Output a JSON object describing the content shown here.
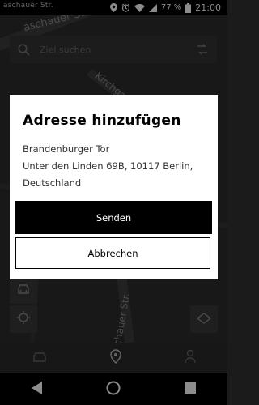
{
  "status_bar": {
    "left_text": "aschauer Str.",
    "battery_percent": "77 %",
    "time": "21:00"
  },
  "map": {
    "street_labels": [
      "aschauer Str.",
      "Kirchgasse",
      "chauer Str."
    ]
  },
  "search": {
    "placeholder": "Ziel suchen"
  },
  "dialog": {
    "title": "Adresse hinzufügen",
    "address_lines": [
      "Brandenburger Tor",
      "Unter den Linden 69B, 10117 Berlin,",
      "Deutschland"
    ],
    "send_label": "Senden",
    "cancel_label": "Abbrechen"
  },
  "icons": {
    "status": [
      "location-icon",
      "alarm-icon",
      "wifi-icon",
      "signal-icon",
      "battery-icon"
    ],
    "map_controls": [
      "car-icon",
      "locate-icon",
      "layers-icon"
    ],
    "bottom_nav": [
      "car-icon",
      "map-pin-icon",
      "person-icon"
    ],
    "system_nav": [
      "back-icon",
      "home-icon",
      "recents-icon"
    ]
  },
  "colors": {
    "dialog_bg": "#ffffff",
    "primary_button": "#000000",
    "scrim": "rgba(0,0,0,0.45)"
  }
}
